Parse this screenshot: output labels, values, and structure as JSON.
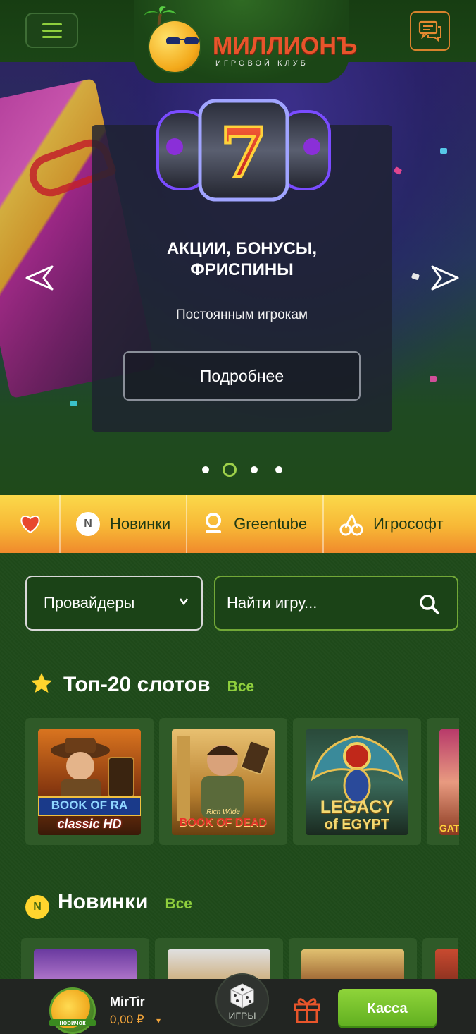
{
  "header": {
    "logo_title": "МИЛЛИОНЪ",
    "logo_subtitle": "ИГРОВОЙ КЛУБ",
    "menu_icon": "hamburger-icon",
    "chat_icon": "chat-bubbles-icon"
  },
  "hero": {
    "title_line1": "АКЦИИ, БОНУСЫ,",
    "title_line2": "ФРИСПИНЫ",
    "subtitle": "Постоянным игрокам",
    "button_label": "Подробнее",
    "slot_symbol": "7",
    "slides_total": 4,
    "active_slide": 2
  },
  "categories": [
    {
      "label": "",
      "icon": "heart-icon"
    },
    {
      "label": "Новинки",
      "icon": "n-badge-icon"
    },
    {
      "label": "Greentube",
      "icon": "greentube-icon"
    },
    {
      "label": "Игрософт",
      "icon": "cherries-icon"
    }
  ],
  "filters": {
    "providers_label": "Провайдеры",
    "search_placeholder": "Найти игру..."
  },
  "sections": {
    "top20": {
      "title": "Топ-20 слотов",
      "all_label": "Все",
      "games": [
        {
          "line1": "BOOK OF RA",
          "line2": "classic HD"
        },
        {
          "line1": "Rich Wilde",
          "line2": "BOOK OF DEAD"
        },
        {
          "line1": "LEGACY",
          "line2": "of EGYPT"
        },
        {
          "line1": "GAT",
          "line2": ""
        }
      ]
    },
    "new": {
      "title": "Новинки",
      "all_label": "Все"
    }
  },
  "bottom": {
    "username": "MirTir",
    "balance": "0,00 ₽",
    "avatar_badge": "новичок",
    "games_label": "ИГРЫ",
    "cashier_label": "Касса"
  },
  "colors": {
    "accent_green": "#8fcf3d",
    "brand_orange": "#e8542b",
    "balance_orange": "#f2a43a"
  }
}
